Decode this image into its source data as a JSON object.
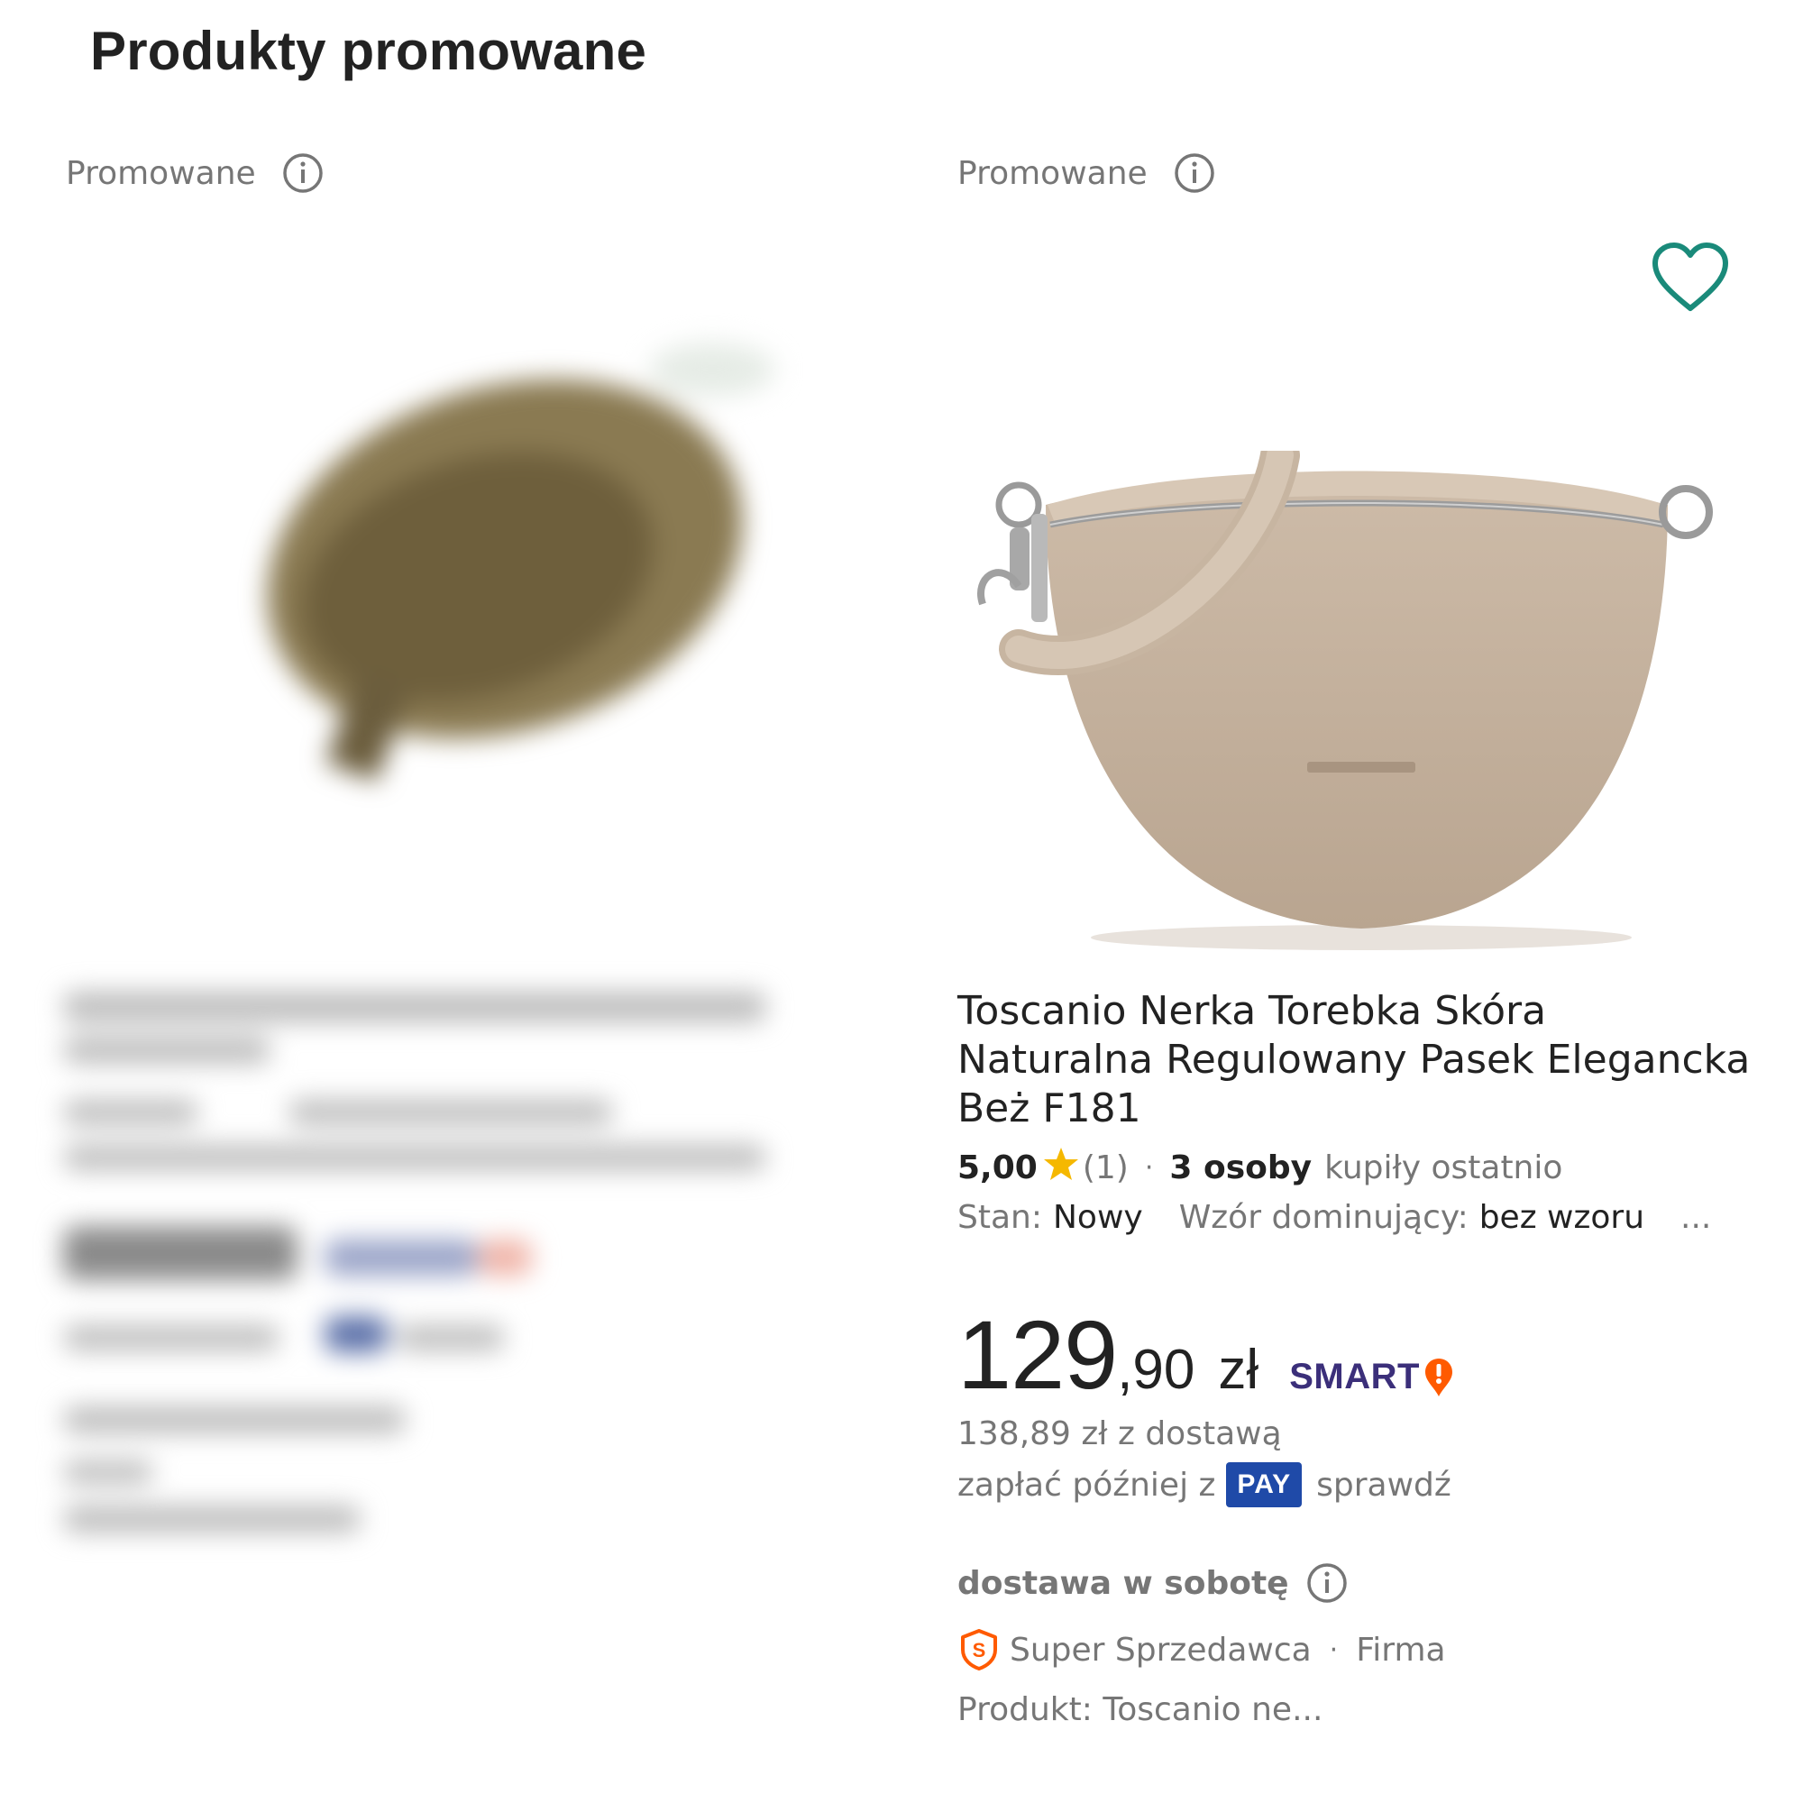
{
  "section": {
    "title": "Produkty promowane"
  },
  "left_card": {
    "promo_label": "Promowane"
  },
  "card": {
    "promo_label": "Promowane",
    "title": "Toscanio Nerka Torebka Skóra Naturalna Regulowany Pasek Elegancka Beż F181",
    "rating": {
      "score": "5,00",
      "count": "(1)",
      "buyers": "3 osoby",
      "buyers_suffix": "kupiły ostatnio"
    },
    "params": {
      "condition_label": "Stan:",
      "condition_value": "Nowy",
      "pattern_label": "Wzór dominujący:",
      "pattern_value": "bez wzoru",
      "more": "..."
    },
    "price": {
      "main": "129",
      "cents": ",90",
      "currency": "zł",
      "smart_label": "SMART"
    },
    "delivery_price": "138,89 zł z dostawą",
    "pay_later": {
      "prefix": "zapłać później z",
      "badge": "PAY",
      "link": "sprawdź"
    },
    "delivery_day": "dostawa w sobotę",
    "seller": {
      "badge": "Super Sprzedawca",
      "type": "Firma"
    },
    "product_meta": "Produkt: Toscanio ne...",
    "colors": {
      "wishlist": "#1a8a7a",
      "star": "#f5b800",
      "smart": "#3b2f7a",
      "smart_icon": "#ff5a00",
      "pay_badge": "#1f4aa8",
      "super_seller": "#ff5a00"
    }
  }
}
